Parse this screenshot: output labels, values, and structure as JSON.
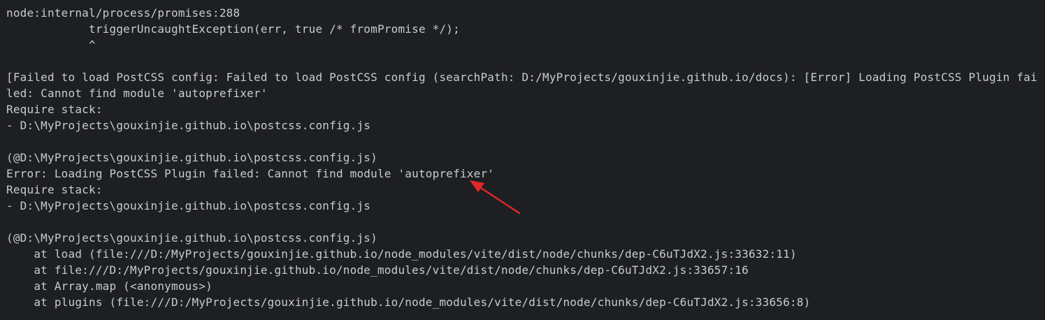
{
  "terminal": {
    "lines": [
      "node:internal/process/promises:288",
      "            triggerUncaughtException(err, true /* fromPromise */);",
      "            ^",
      "",
      "[Failed to load PostCSS config: Failed to load PostCSS config (searchPath: D:/MyProjects/gouxinjie.github.io/docs): [Error] Loading PostCSS Plugin fai",
      "led: Cannot find module 'autoprefixer'",
      "Require stack:",
      "- D:\\MyProjects\\gouxinjie.github.io\\postcss.config.js",
      "",
      "(@D:\\MyProjects\\gouxinjie.github.io\\postcss.config.js)",
      "Error: Loading PostCSS Plugin failed: Cannot find module 'autoprefixer'",
      "Require stack:",
      "- D:\\MyProjects\\gouxinjie.github.io\\postcss.config.js",
      "",
      "(@D:\\MyProjects\\gouxinjie.github.io\\postcss.config.js)",
      "    at load (file:///D:/MyProjects/gouxinjie.github.io/node_modules/vite/dist/node/chunks/dep-C6uTJdX2.js:33632:11)",
      "    at file:///D:/MyProjects/gouxinjie.github.io/node_modules/vite/dist/node/chunks/dep-C6uTJdX2.js:33657:16",
      "    at Array.map (<anonymous>)",
      "    at plugins (file:///D:/MyProjects/gouxinjie.github.io/node_modules/vite/dist/node/chunks/dep-C6uTJdX2.js:33656:8)"
    ]
  },
  "colors": {
    "background": "#1e1f22",
    "text": "#c8cbd0",
    "annotation_arrow": "#e0282a"
  },
  "icons": {
    "annotation": "red-arrow-icon"
  }
}
